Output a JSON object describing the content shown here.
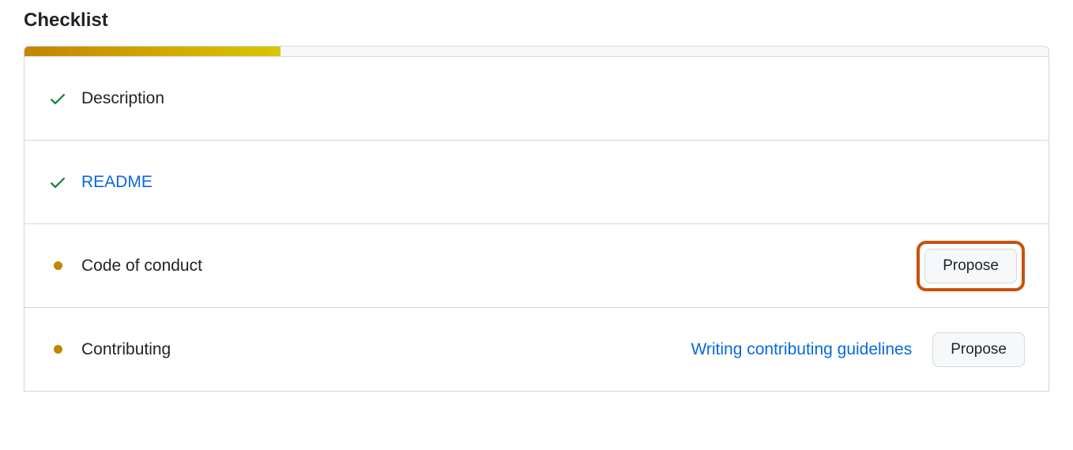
{
  "heading": "Checklist",
  "progress": {
    "percent": 25
  },
  "items": [
    {
      "label": "Description",
      "status": "done",
      "link": false
    },
    {
      "label": "README",
      "status": "done",
      "link": true
    },
    {
      "label": "Code of conduct",
      "status": "pending",
      "action": "Propose",
      "highlight": true
    },
    {
      "label": "Contributing",
      "status": "pending",
      "help": "Writing contributing guidelines",
      "action": "Propose"
    }
  ],
  "colors": {
    "accent": "#0969da",
    "warning": "#bf8700",
    "highlight": "#c9510c",
    "success": "#1a7f37"
  }
}
